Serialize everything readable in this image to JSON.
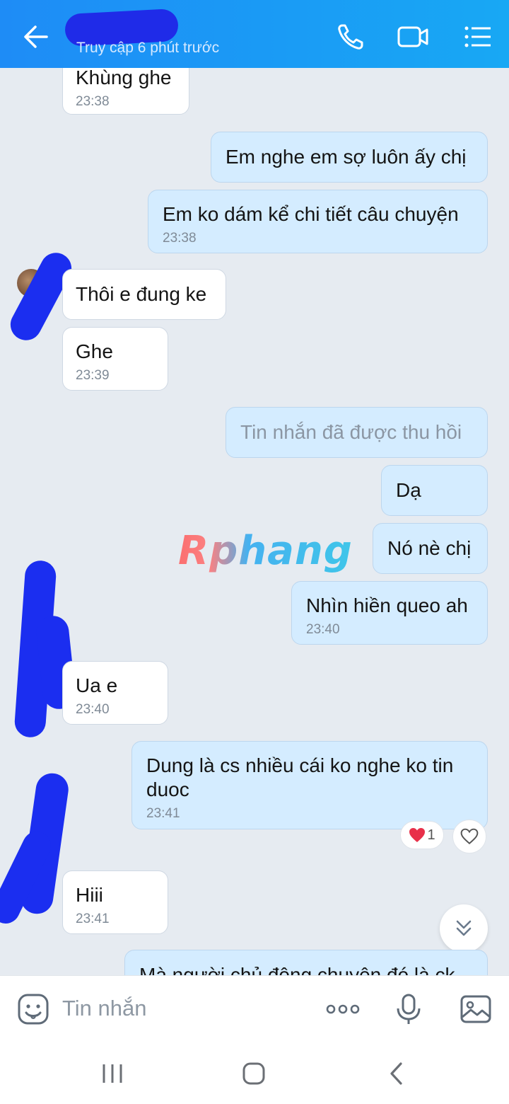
{
  "header": {
    "contact_name": "",
    "last_seen": "Truy cập 6 phút trước",
    "icons": [
      "back-arrow-icon",
      "phone-icon",
      "video-call-icon",
      "menu-icon"
    ],
    "accent_color": "#1a9bf5"
  },
  "messages": [
    {
      "direction": "in",
      "text": "Khùng ghe",
      "time": "23:38"
    },
    {
      "direction": "out",
      "text": "Em nghe em sợ luôn ấy chị",
      "time": ""
    },
    {
      "direction": "out",
      "text": "Em ko dám kể chi tiết câu chuyện",
      "time": "23:38"
    },
    {
      "direction": "in",
      "text": "Thôi e đung ke",
      "time": ""
    },
    {
      "direction": "in",
      "text": "Ghe",
      "time": "23:39"
    },
    {
      "direction": "out",
      "text": "Tin nhắn đã được thu hồi",
      "time": "",
      "recalled": true
    },
    {
      "direction": "out",
      "text": "Dạ",
      "time": ""
    },
    {
      "direction": "out",
      "text": "Nó nè chị",
      "time": ""
    },
    {
      "direction": "out",
      "text": "Nhìn hiền queo ah",
      "time": "23:40"
    },
    {
      "direction": "in",
      "text": "Ua e",
      "time": "23:40"
    },
    {
      "direction": "out",
      "text": "Dung là cs nhiều cái ko nghe ko tin\nduoc",
      "time": "23:41"
    },
    {
      "direction": "in",
      "text": "Hiii",
      "time": "23:41"
    },
    {
      "direction": "out",
      "text": "Mà người chủ động chuyện đó là ck",
      "time": ""
    }
  ],
  "reaction": {
    "emoji": "heart",
    "count": "1"
  },
  "watermark": "Rphang",
  "input": {
    "placeholder": "Tin nhắn"
  },
  "colors": {
    "out_bubble": "#d4ecff",
    "in_bubble": "#ffffff",
    "background": "#e6ebf1",
    "redaction": "#1b2ef0"
  }
}
